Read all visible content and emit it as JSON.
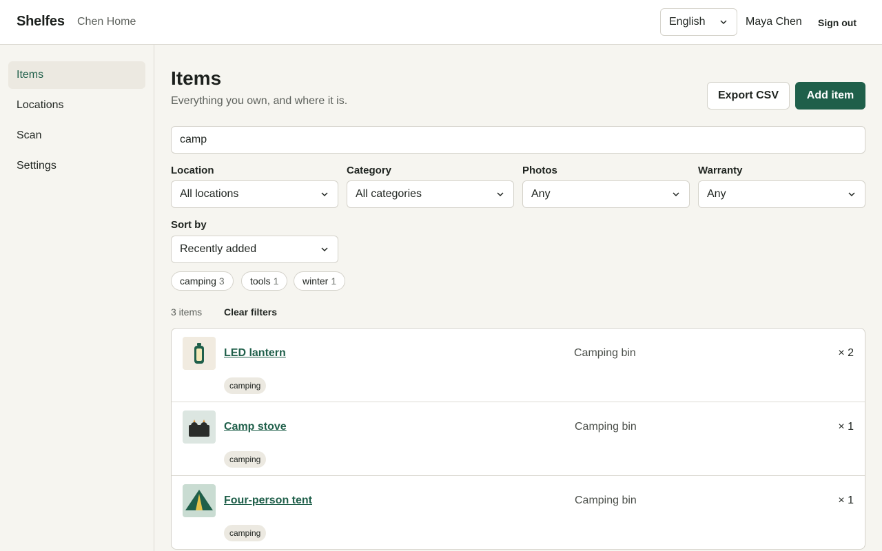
{
  "header": {
    "brand": "Shelfes",
    "household": "Chen Home",
    "language": "English",
    "user_name": "Maya Chen",
    "sign_out": "Sign out"
  },
  "sidebar": {
    "items": [
      {
        "label": "Items",
        "active": true
      },
      {
        "label": "Locations",
        "active": false
      },
      {
        "label": "Scan",
        "active": false
      },
      {
        "label": "Settings",
        "active": false
      }
    ]
  },
  "main": {
    "title": "Items",
    "subtitle": "Everything you own, and where it is.",
    "export_label": "Export CSV",
    "add_label": "Add item",
    "search_value": "camp",
    "filters": {
      "location": {
        "label": "Location",
        "value": "All locations"
      },
      "category": {
        "label": "Category",
        "value": "All categories"
      },
      "photos": {
        "label": "Photos",
        "value": "Any"
      },
      "warranty": {
        "label": "Warranty",
        "value": "Any"
      },
      "sort": {
        "label": "Sort by",
        "value": "Recently added"
      }
    },
    "tags": [
      {
        "name": "camping",
        "count": "3"
      },
      {
        "name": "tools",
        "count": "1"
      },
      {
        "name": "winter",
        "count": "1"
      }
    ],
    "result_count": "3 items",
    "clear_filters": "Clear filters",
    "items": [
      {
        "name": "LED lantern",
        "location": "Camping bin",
        "qty": "× 2",
        "tag": "camping",
        "icon": "lantern-icon"
      },
      {
        "name": "Camp stove",
        "location": "Camping bin",
        "qty": "× 1",
        "tag": "camping",
        "icon": "stove-icon"
      },
      {
        "name": "Four-person tent",
        "location": "Camping bin",
        "qty": "× 1",
        "tag": "camping",
        "icon": "tent-icon"
      }
    ]
  },
  "colors": {
    "accent": "#1f5f4a",
    "background": "#f6f5f0",
    "border": "#d4d2ca"
  }
}
